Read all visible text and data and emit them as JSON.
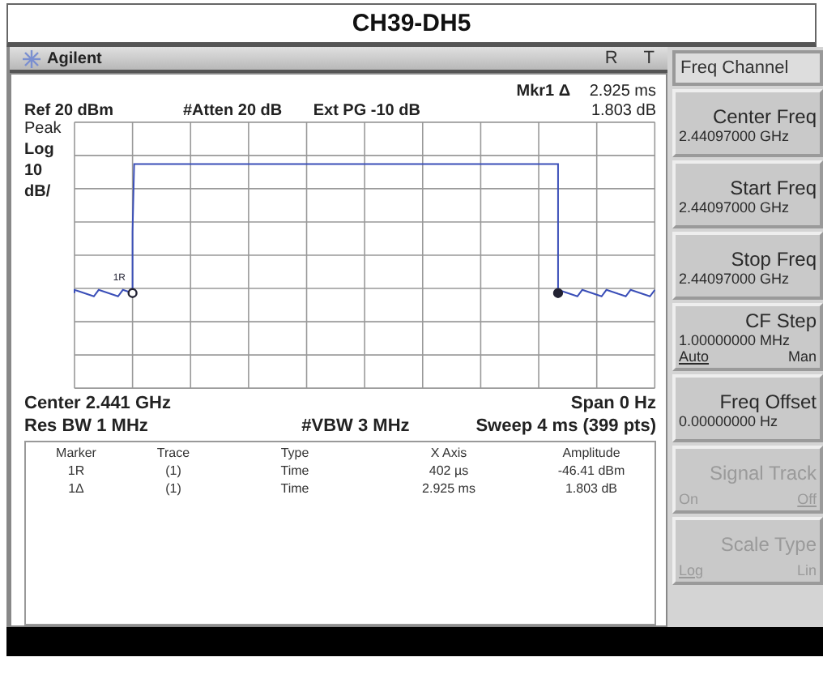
{
  "window": {
    "title": "CH39-DH5"
  },
  "header": {
    "brand": "Agilent",
    "indicators": [
      "R",
      "T"
    ]
  },
  "annotations": {
    "marker_label": "Mkr1 Δ",
    "marker_time": "2.925 ms",
    "ref": "Ref 20 dBm",
    "atten": "#Atten 20 dB",
    "ext_pg": "Ext PG -10 dB",
    "marker_delta": "1.803 dB",
    "scale_labels": [
      "Peak",
      "Log",
      "10",
      "dB/"
    ],
    "center": "Center 2.441 GHz",
    "span": "Span 0 Hz",
    "res_bw": "Res BW 1 MHz",
    "vbw": "#VBW 3 MHz",
    "sweep": "Sweep 4 ms (399 pts)"
  },
  "trace": {
    "marker_label": "1R"
  },
  "marker_table": {
    "columns": [
      "Marker",
      "Trace",
      "Type",
      "X Axis",
      "Amplitude"
    ],
    "rows": [
      [
        "1R",
        "(1)",
        "Time",
        "402 µs",
        "-46.41 dBm"
      ],
      [
        "1Δ",
        "(1)",
        "Time",
        "2.925 ms",
        "1.803 dB"
      ]
    ]
  },
  "menu": {
    "title": "Freq Channel",
    "keys": [
      {
        "kind": "value",
        "label": "Center Freq",
        "value": "2.44097000 GHz",
        "disabled": false
      },
      {
        "kind": "value",
        "label": "Start Freq",
        "value": "2.44097000 GHz",
        "disabled": false
      },
      {
        "kind": "value",
        "label": "Stop Freq",
        "value": "2.44097000 GHz",
        "disabled": false
      },
      {
        "kind": "toggle",
        "label": "CF Step",
        "value": "1.00000000 MHz",
        "disabled": false,
        "options": [
          {
            "label": "Auto",
            "selected": true
          },
          {
            "label": "Man",
            "selected": false
          }
        ]
      },
      {
        "kind": "value",
        "label": "Freq Offset",
        "value": "0.00000000  Hz",
        "disabled": false
      },
      {
        "kind": "toggle",
        "label": "Signal Track",
        "disabled": true,
        "options": [
          {
            "label": "On",
            "selected": false
          },
          {
            "label": "Off",
            "selected": true
          }
        ]
      },
      {
        "kind": "toggle",
        "label": "Scale Type",
        "disabled": true,
        "options": [
          {
            "label": "Log",
            "selected": true
          },
          {
            "label": "Lin",
            "selected": false
          }
        ]
      }
    ]
  }
}
